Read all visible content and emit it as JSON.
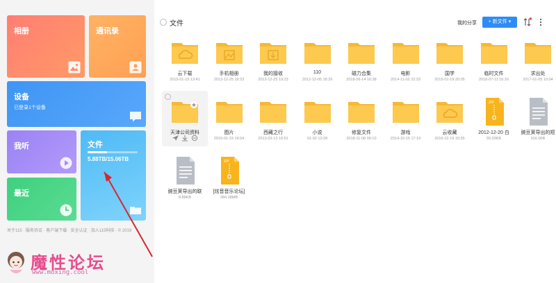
{
  "sidebar": {
    "tiles": {
      "album": {
        "label": "相册"
      },
      "contacts": {
        "label": "通讯录"
      },
      "devices": {
        "label": "设备",
        "sub": "已登录1个设备"
      },
      "listen": {
        "label": "我听"
      },
      "recent": {
        "label": "最近"
      },
      "files": {
        "label": "文件",
        "usage": "5.88TB/15.06TB",
        "used_fraction": 0.39
      }
    },
    "footer": "关于115 · 服务协议 · 客户端下载 · 安全认证 · 加入115科技 · © 2019"
  },
  "watermark": {
    "title": "魔性论坛",
    "url": "www.moxing.cool"
  },
  "main": {
    "title": "文件",
    "my_share": "我的分享",
    "new_button": "+ 新文件",
    "items": [
      {
        "name": "云下载",
        "date": "2015-01-15 13:41",
        "icon": "cloud-folder"
      },
      {
        "name": "手机相册",
        "date": "2013-12-25 19:23",
        "icon": "photo-folder"
      },
      {
        "name": "我的接收",
        "date": "2013-12-25 19:23",
        "icon": "receive-folder"
      },
      {
        "name": "110",
        "date": "2012-12-05 18:29",
        "icon": "folder"
      },
      {
        "name": "磁力合集",
        "date": "2018-06-14 16:38",
        "icon": "folder"
      },
      {
        "name": "电影",
        "date": "2014-11-02 22:33",
        "icon": "folder"
      },
      {
        "name": "国学",
        "date": "2015-01-19 20:05",
        "icon": "folder"
      },
      {
        "name": "临时文件",
        "date": "2018-07-11 16:16",
        "icon": "folder"
      },
      {
        "name": "求出处",
        "date": "2017-01-05 10:04",
        "icon": "folder"
      },
      {
        "name": "天津公司资料",
        "date": "",
        "icon": "starred-folder"
      },
      {
        "name": "图片",
        "date": "2015-01-19 19:54",
        "icon": "folder"
      },
      {
        "name": "西藏之行",
        "date": "2013-03-13 16:51",
        "icon": "folder"
      },
      {
        "name": "小说",
        "date": "01-02 13:28",
        "icon": "folder"
      },
      {
        "name": "修复文件",
        "date": "2018-11-08 09:10",
        "icon": "folder"
      },
      {
        "name": "游戏",
        "date": "2014-10-15 17:14",
        "icon": "folder"
      },
      {
        "name": "云收藏",
        "date": "2016-12-19 16:55",
        "icon": "cloud-folder"
      },
      {
        "name": "2012-12-20 白",
        "date": "55.03KB",
        "icon": "zip-file"
      },
      {
        "name": "豌豆荚导出的短",
        "date": "916.00B",
        "icon": "doc-file"
      },
      {
        "name": "豌豆荚导出的联",
        "date": "8.88KB",
        "icon": "doc-file"
      },
      {
        "name": "[炫音音乐论坛]",
        "date": "284.38MB",
        "icon": "zip-file"
      }
    ]
  },
  "colors": {
    "accent": "#2f8cf5",
    "folder": "#fdc94e",
    "watermark": "#e84c8e"
  }
}
